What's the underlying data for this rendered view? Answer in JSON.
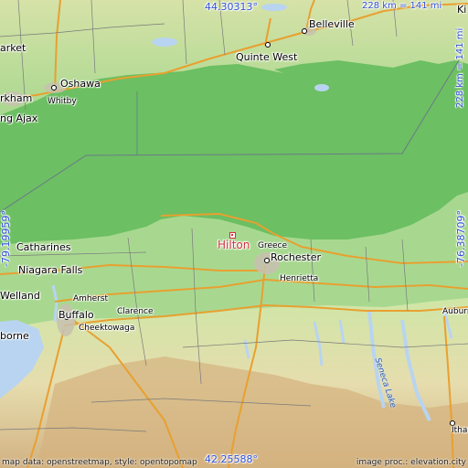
{
  "coords": {
    "top": "44.30313°",
    "bottom": "42.25588°",
    "left": "-79.19959°",
    "right": "-76.38709°"
  },
  "scale": {
    "horizontal": "228 km = 141 mi",
    "vertical": "228 km = 141 mi"
  },
  "highlight": {
    "name": "Hilton"
  },
  "places": [
    {
      "id": "market",
      "name": "arket"
    },
    {
      "id": "oshawa",
      "name": "Oshawa"
    },
    {
      "id": "whitby",
      "name": "Whitby"
    },
    {
      "id": "markham",
      "name": "rkham"
    },
    {
      "id": "ajax",
      "name": "ng Ajax"
    },
    {
      "id": "belleville",
      "name": "Belleville"
    },
    {
      "id": "quinte-west",
      "name": "Quinte West"
    },
    {
      "id": "ki",
      "name": "Ki"
    },
    {
      "id": "greece",
      "name": "Greece"
    },
    {
      "id": "rochester",
      "name": "Rochester"
    },
    {
      "id": "henrietta",
      "name": "Henrietta"
    },
    {
      "id": "catharines",
      "name": "Catharines"
    },
    {
      "id": "niagara-falls",
      "name": "Niagara Falls"
    },
    {
      "id": "welland",
      "name": "Welland"
    },
    {
      "id": "amherst",
      "name": "Amherst"
    },
    {
      "id": "buffalo",
      "name": "Buffalo"
    },
    {
      "id": "clarence",
      "name": "Clarence"
    },
    {
      "id": "cheektowaga",
      "name": "Cheektowaga"
    },
    {
      "id": "borne",
      "name": "borne"
    },
    {
      "id": "auburn",
      "name": "Auburn"
    },
    {
      "id": "ithaca",
      "name": "Ithac"
    },
    {
      "id": "seneca-lake",
      "name": "Seneca Lake"
    }
  ],
  "credits": {
    "left": "map data: openstreetmap, style: opentopomap",
    "right": "image proc.: elevation.city"
  },
  "colors": {
    "lake": "#6cbf62",
    "land_low": "#a8d890",
    "land_mid": "#e6ddae",
    "hills": "#d7b98a",
    "water_blue": "#b8d4f0",
    "road": "#e8a030",
    "coord_text": "#2e4fd8",
    "highlight": "#d0303a"
  }
}
